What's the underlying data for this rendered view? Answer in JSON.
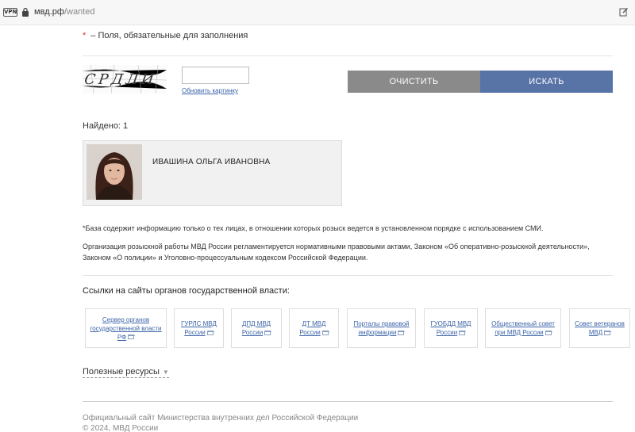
{
  "browser": {
    "vpn_label": "VPN",
    "url_domain": "мвд.рф",
    "url_path": "/wanted"
  },
  "form": {
    "required_star": "*",
    "required_note": "– Поля, обязательные для заполнения",
    "captcha_text": "СРДЛИ",
    "captcha_value": "",
    "refresh_link": "Обновить картинку",
    "clear_button": "ОЧИСТИТЬ",
    "search_button": "ИСКАТЬ"
  },
  "results": {
    "found_label": "Найдено: 1",
    "items": [
      {
        "name": "ИВАШИНА ОЛЬГА ИВАНОВНА"
      }
    ]
  },
  "notes": {
    "note1": "*База содержит информацию только о тех лицах, в отношении которых розыск ведется в установленном порядке с использованием СМИ.",
    "note2": "Организация розыскной работы МВД России регламентируется нормативными правовыми актами, Законом «Об оперативно-розыскной деятельности», Законом «О полиции» и Уголовно-процессуальным кодексом Российской Федерации."
  },
  "gov_links": {
    "title": "Ссылки на сайты органов государственной власти:",
    "items": [
      {
        "label": "Сервер органов государственной власти РФ"
      },
      {
        "label": "ГУРЛС МВД России"
      },
      {
        "label": "ДПД МВД России"
      },
      {
        "label": "ДТ МВД России"
      },
      {
        "label": "Порталы правовой информации"
      },
      {
        "label": "ГУОБДД МВД России"
      },
      {
        "label": "Общественный совет при МВД России"
      },
      {
        "label": "Совет ветеранов МВД"
      }
    ]
  },
  "useful": {
    "label": "Полезные ресурсы",
    "chevron": "▼"
  },
  "footer": {
    "line1": "Официальный сайт Министерства внутренних дел Российской Федерации",
    "line2": "© 2024, МВД России"
  }
}
